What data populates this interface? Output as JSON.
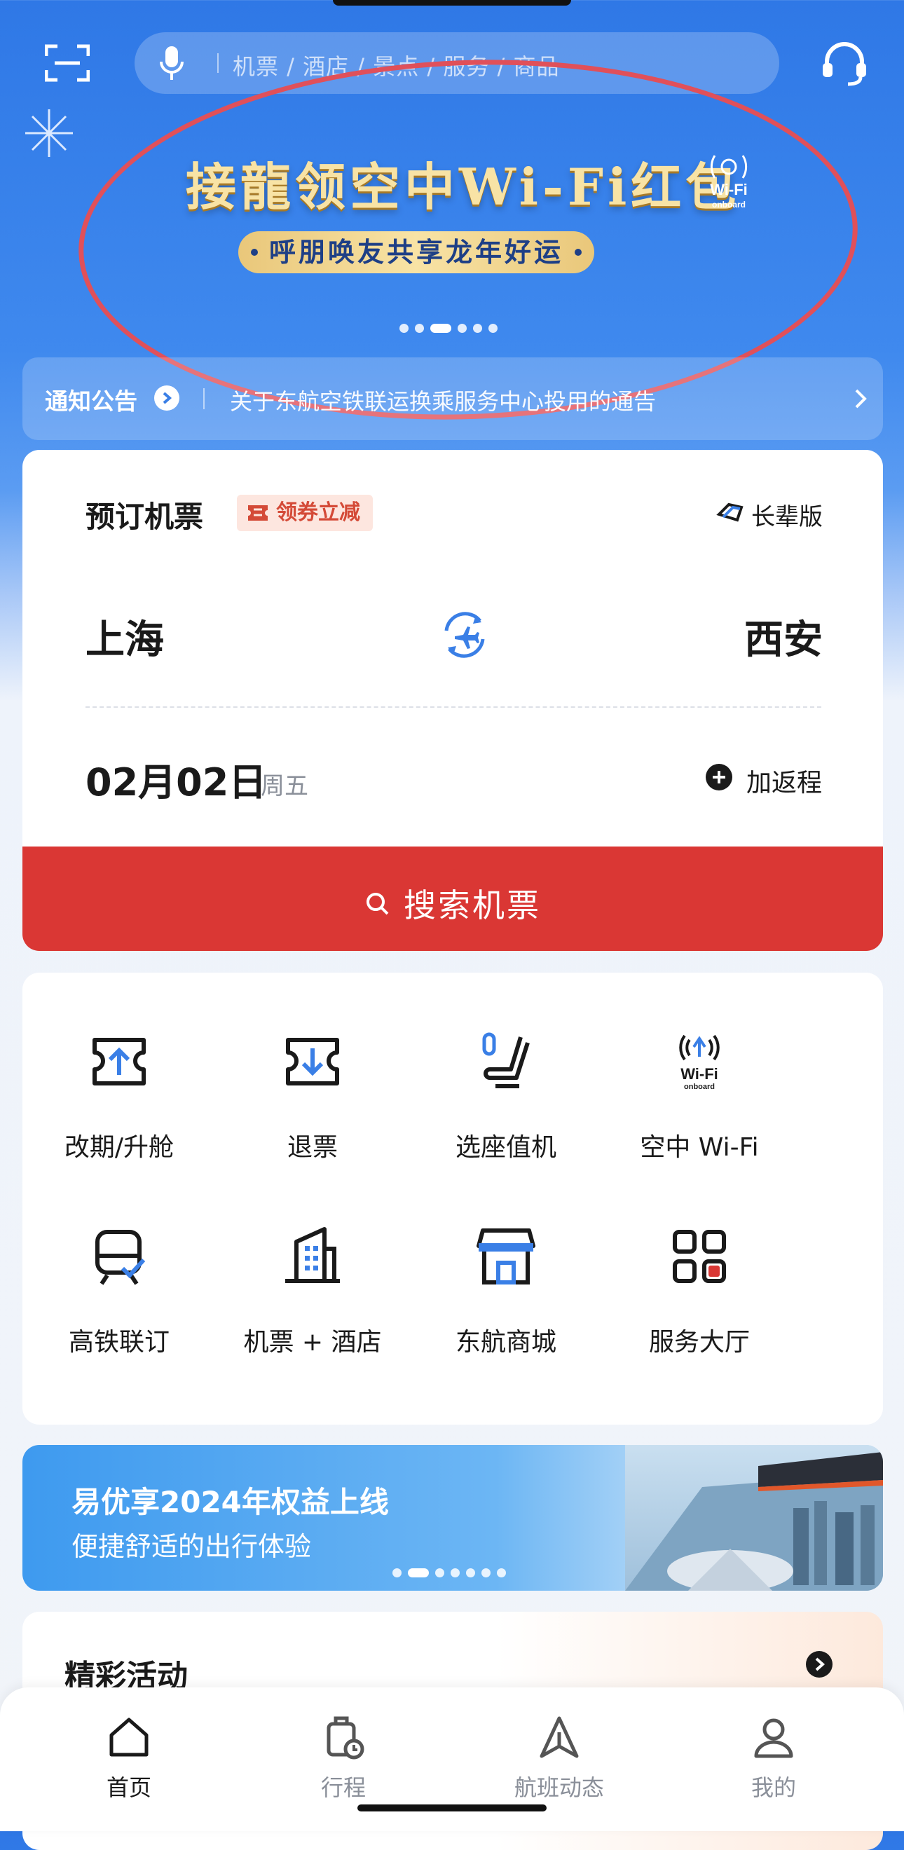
{
  "search": {
    "placeholder": "机票 / 酒店 / 景点 / 服务 / 商品"
  },
  "icons": {
    "scan": "scan-icon",
    "mic": "microphone-icon",
    "service": "customer-service-icon"
  },
  "banner": {
    "title": "接龍领空中Wi-Fi红包",
    "subtitle": "呼朋唤友共享龙年好运",
    "badge_top": "Wi-Fi",
    "badge_bottom": "onboard",
    "slide_count": 6,
    "active_slide": 2
  },
  "notice": {
    "label": "通知公告",
    "text": "关于东航空铁联运换乘服务中心投用的通告"
  },
  "booking": {
    "title": "预订机票",
    "coupon": "领券立减",
    "elder_mode": "长辈版",
    "origin": "上海",
    "destination": "西安",
    "date": "02月02日",
    "weekday": "周五",
    "add_return": "加返程",
    "search_button": "搜索机票"
  },
  "services": [
    {
      "label": "改期/升舱",
      "icon": "ticket-upgrade-icon"
    },
    {
      "label": "退票",
      "icon": "ticket-refund-icon"
    },
    {
      "label": "选座值机",
      "icon": "seat-checkin-icon"
    },
    {
      "label": "空中 Wi-Fi",
      "icon": "wifi-onboard-icon"
    },
    {
      "label": "高铁联订",
      "icon": "train-icon"
    },
    {
      "label": "机票 + 酒店",
      "icon": "hotel-icon"
    },
    {
      "label": "东航商城",
      "icon": "store-icon"
    },
    {
      "label": "服务大厅",
      "icon": "service-hall-icon"
    }
  ],
  "promo": {
    "title": "易优享2024年权益上线",
    "subtitle": "便捷舒适的出行体验",
    "slide_count": 7,
    "active_slide": 1
  },
  "activities": {
    "title": "精彩活动"
  },
  "tabs": [
    {
      "label": "首页",
      "icon": "home-icon",
      "active": true
    },
    {
      "label": "行程",
      "icon": "itinerary-icon",
      "active": false
    },
    {
      "label": "航班动态",
      "icon": "flight-status-icon",
      "active": false
    },
    {
      "label": "我的",
      "icon": "profile-icon",
      "active": false
    }
  ],
  "colors": {
    "brand_blue": "#2f78e6",
    "accent_red": "#da3734",
    "banner_gold": "#f8e3a5",
    "annotation_red": "#e0505a"
  }
}
